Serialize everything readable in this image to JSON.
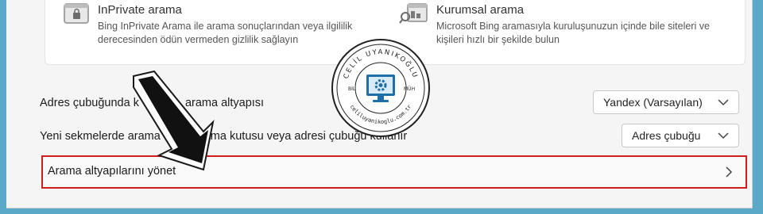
{
  "features": {
    "inprivate": {
      "title": "InPrivate arama",
      "desc_line1": "Bing InPrivate Arama ile arama sonuçlarından veya ilgililik",
      "desc_line2": "derecesinden ödün vermeden gizlilik sağlayın",
      "icon": "private-window-lock-icon"
    },
    "enterprise": {
      "title": "Kurumsal arama",
      "desc_line1": "Microsoft Bing aramasıyla kuruluşunuzun içinde bile siteleri ve",
      "desc_line2": "kişileri hızlı bir şekilde bulun",
      "icon": "enterprise-search-icon"
    }
  },
  "settings": {
    "address_bar_engine": {
      "label_start": "Adres çubuğunda k",
      "label_end": "arama altyapısı",
      "value": "Yandex (Varsayılan)"
    },
    "new_tab_search": {
      "label_start": "Yeni sekmelerde arama",
      "label_end": ", arama kutusu veya adresi çubuğu kullanır",
      "value": "Adres çubuğu"
    },
    "manage_engines": {
      "label": "Arama altyapılarını yönet"
    }
  },
  "watermark": {
    "top_text": "CELİL UYANIKOĞLU",
    "left_text": "BİL",
    "right_text": "MÜH",
    "bottom_text": "celiluyanikoglu.com.tr"
  },
  "colors": {
    "highlight_border": "#d31c1c",
    "stamp_blue": "#1e6fa8"
  }
}
